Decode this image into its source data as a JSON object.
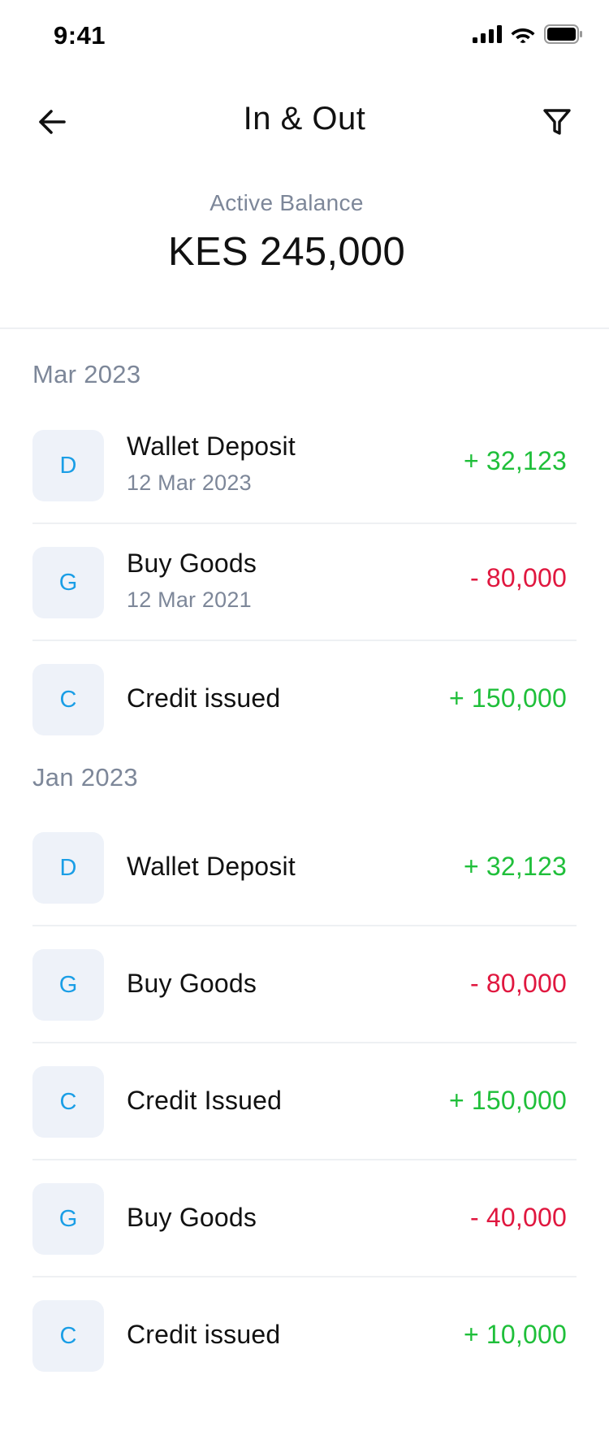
{
  "status_bar": {
    "time": "9:41"
  },
  "header": {
    "title": "In & Out"
  },
  "balance": {
    "label": "Active Balance",
    "value": "KES 245,000"
  },
  "groups": [
    {
      "month": "Mar 2023",
      "items": [
        {
          "initial": "D",
          "title": "Wallet Deposit",
          "date": "12 Mar 2023",
          "amount": "+ 32,123",
          "type": "credit"
        },
        {
          "initial": "G",
          "title": "Buy Goods",
          "date": "12 Mar 2021",
          "amount": "- 80,000",
          "type": "debit"
        },
        {
          "initial": "C",
          "title": "Credit issued",
          "date": "",
          "amount": "+ 150,000",
          "type": "credit"
        }
      ]
    },
    {
      "month": "Jan 2023",
      "items": [
        {
          "initial": "D",
          "title": "Wallet Deposit",
          "date": "",
          "amount": "+ 32,123",
          "type": "credit"
        },
        {
          "initial": "G",
          "title": "Buy Goods",
          "date": "",
          "amount": "- 80,000",
          "type": "debit"
        },
        {
          "initial": "C",
          "title": "Credit Issued",
          "date": "",
          "amount": "+ 150,000",
          "type": "credit"
        },
        {
          "initial": "G",
          "title": "Buy Goods",
          "date": "",
          "amount": "- 40,000",
          "type": "debit"
        },
        {
          "initial": "C",
          "title": "Credit issued",
          "date": "",
          "amount": "+ 10,000",
          "type": "credit"
        }
      ]
    }
  ],
  "colors": {
    "credit": "#1fbf3a",
    "debit": "#e0173f",
    "avatar_letter": "#1a9ee6",
    "avatar_bg": "#eef2f9"
  },
  "icons": {
    "back": "arrow-left-icon",
    "filter": "filter-icon"
  }
}
